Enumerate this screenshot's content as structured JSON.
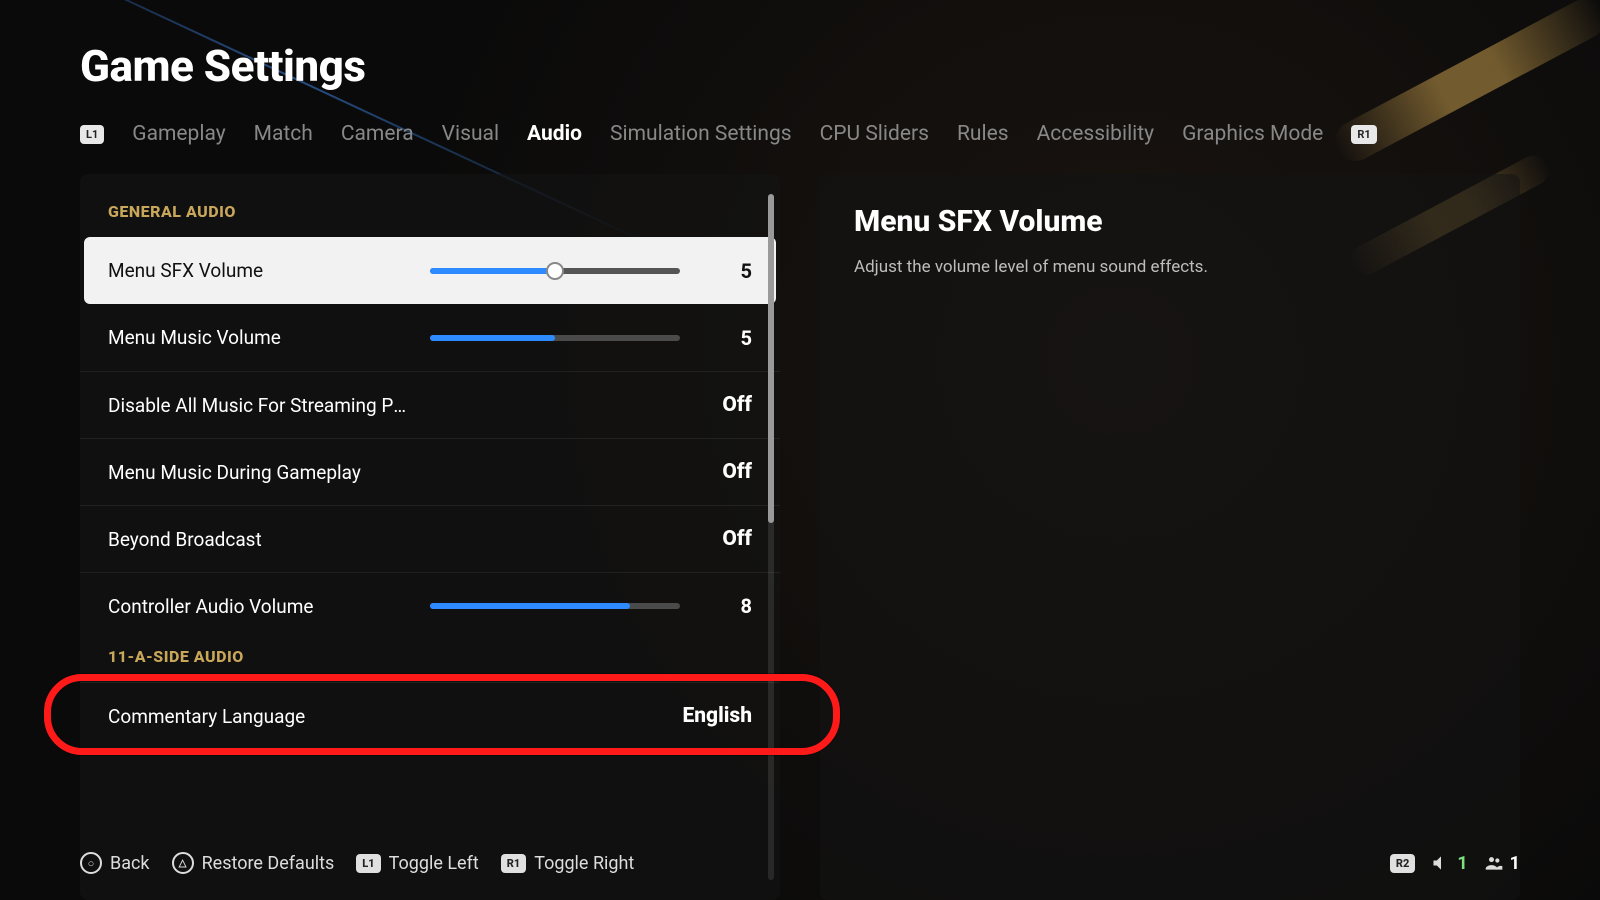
{
  "title": "Game Settings",
  "tabs": {
    "left_bumper": "L1",
    "right_bumper": "R1",
    "items": [
      "Gameplay",
      "Match",
      "Camera",
      "Visual",
      "Audio",
      "Simulation Settings",
      "CPU Sliders",
      "Rules",
      "Accessibility",
      "Graphics Mode"
    ],
    "active_index": 4
  },
  "sections": [
    {
      "header": "GENERAL AUDIO",
      "rows": [
        {
          "kind": "slider",
          "label": "Menu SFX Volume",
          "value": 5,
          "max": 10,
          "selected": true
        },
        {
          "kind": "slider",
          "label": "Menu Music Volume",
          "value": 5,
          "max": 10
        },
        {
          "kind": "toggle",
          "label": "Disable All Music For Streaming Pu…",
          "value": "Off"
        },
        {
          "kind": "toggle",
          "label": "Menu Music During Gameplay",
          "value": "Off"
        },
        {
          "kind": "toggle",
          "label": "Beyond Broadcast",
          "value": "Off"
        },
        {
          "kind": "slider",
          "label": "Controller Audio Volume",
          "value": 8,
          "max": 10
        }
      ]
    },
    {
      "header": "11-A-SIDE AUDIO",
      "rows": [
        {
          "kind": "enum",
          "label": "Commentary Language",
          "value": "English",
          "highlighted": true
        }
      ]
    }
  ],
  "info": {
    "title": "Menu SFX Volume",
    "desc": "Adjust the volume level of menu sound effects."
  },
  "footer": {
    "back": "Back",
    "restore": "Restore Defaults",
    "toggle_left": "Toggle Left",
    "toggle_right": "Toggle Right",
    "l1": "L1",
    "r1": "R1",
    "r2": "R2",
    "stat1": "1",
    "stat2": "1"
  }
}
